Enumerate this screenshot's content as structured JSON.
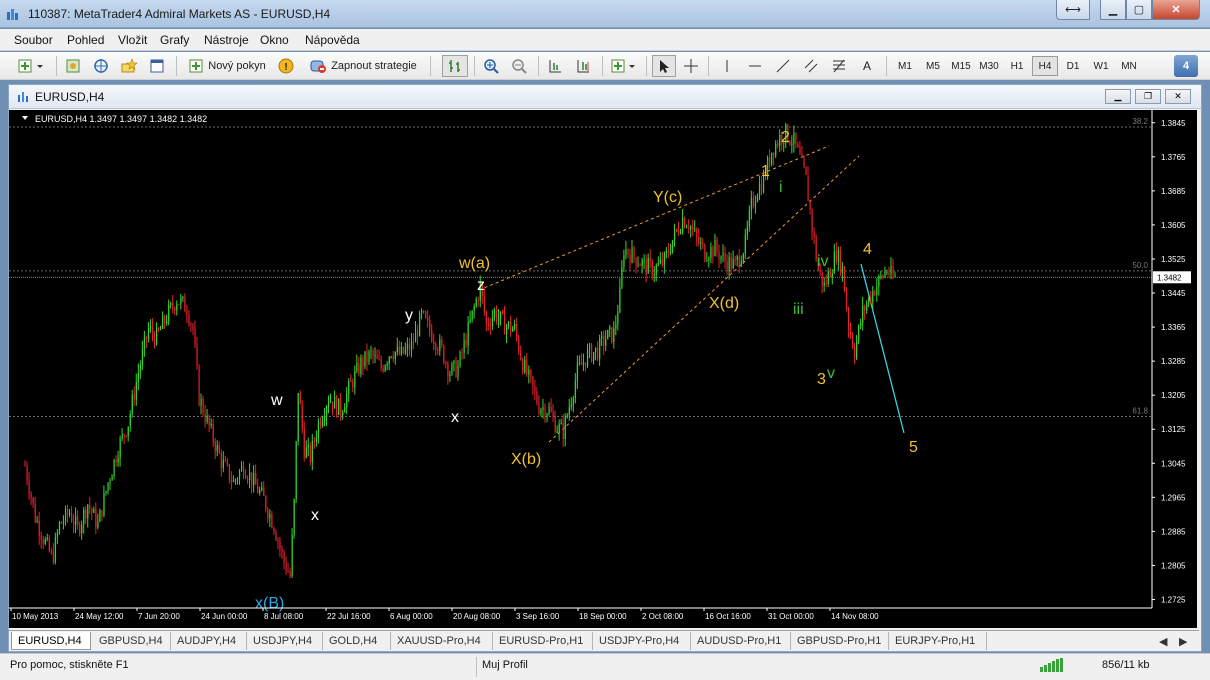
{
  "window": {
    "title": "110387: MetaTrader4 Admiral Markets AS - EURUSD,H4"
  },
  "menu": [
    "Soubor",
    "Pohled",
    "Vložit",
    "Grafy",
    "Nástroje",
    "Okno",
    "Nápověda"
  ],
  "toolbar": {
    "new_order": "Nový pokyn",
    "autotrading": "Zapnout strategie",
    "text_tool": "A",
    "timeframes": [
      "M1",
      "M5",
      "M15",
      "M30",
      "H1",
      "H4",
      "D1",
      "W1",
      "MN"
    ],
    "active_timeframe": "H4",
    "badge": "4"
  },
  "child": {
    "title": "EURUSD,H4"
  },
  "chart_data": {
    "type": "candlestick",
    "symbol_info": "EURUSD,H4  1.3497 1.3497 1.3482 1.3482",
    "current_price": "1.3482",
    "y_ticks": [
      "1.3845",
      "1.3765",
      "1.3685",
      "1.3605",
      "1.3525",
      "1.3445",
      "1.3365",
      "1.3285",
      "1.3205",
      "1.3125",
      "1.3045",
      "1.2965",
      "1.2885",
      "1.2805",
      "1.2725"
    ],
    "x_ticks": [
      "10 May 2013",
      "24 May 12:00",
      "7 Jun 20:00",
      "24 Jun 00:00",
      "8 Jul 08:00",
      "22 Jul 16:00",
      "6 Aug 00:00",
      "20 Aug 08:00",
      "3 Sep 16:00",
      "18 Sep 00:00",
      "2 Oct 08:00",
      "16 Oct 16:00",
      "31 Oct 00:00",
      "14 Nov 08:00"
    ],
    "fib_levels": [
      {
        "label": "38.2",
        "price": 1.3835
      },
      {
        "label": "50.0",
        "price": 1.3497
      },
      {
        "label": "61.8",
        "price": 1.3155
      }
    ],
    "ylim": [
      1.2705,
      1.3875
    ],
    "path": [
      [
        0,
        1.304
      ],
      [
        10,
        1.292
      ],
      [
        18,
        1.287
      ],
      [
        27,
        1.282
      ],
      [
        34,
        1.29
      ],
      [
        44,
        1.293
      ],
      [
        52,
        1.289
      ],
      [
        62,
        1.295
      ],
      [
        72,
        1.29
      ],
      [
        82,
        1.3
      ],
      [
        92,
        1.308
      ],
      [
        102,
        1.314
      ],
      [
        112,
        1.326
      ],
      [
        122,
        1.336
      ],
      [
        130,
        1.334
      ],
      [
        140,
        1.339
      ],
      [
        150,
        1.343
      ],
      [
        160,
        1.341
      ],
      [
        166,
        1.336
      ],
      [
        172,
        1.32
      ],
      [
        182,
        1.313
      ],
      [
        194,
        1.305
      ],
      [
        206,
        1.3
      ],
      [
        216,
        1.304
      ],
      [
        226,
        1.3
      ],
      [
        236,
        1.296
      ],
      [
        246,
        1.29
      ],
      [
        255,
        1.282
      ],
      [
        262,
        1.278
      ],
      [
        266,
        1.295
      ],
      [
        270,
        1.322
      ],
      [
        276,
        1.308
      ],
      [
        282,
        1.306
      ],
      [
        290,
        1.314
      ],
      [
        300,
        1.32
      ],
      [
        312,
        1.317
      ],
      [
        322,
        1.323
      ],
      [
        332,
        1.328
      ],
      [
        342,
        1.33
      ],
      [
        352,
        1.327
      ],
      [
        362,
        1.331
      ],
      [
        372,
        1.33
      ],
      [
        382,
        1.332
      ],
      [
        392,
        1.339
      ],
      [
        402,
        1.335
      ],
      [
        412,
        1.331
      ],
      [
        420,
        1.326
      ],
      [
        428,
        1.327
      ],
      [
        436,
        1.334
      ],
      [
        444,
        1.341
      ],
      [
        450,
        1.346
      ],
      [
        456,
        1.337
      ],
      [
        464,
        1.34
      ],
      [
        474,
        1.337
      ],
      [
        484,
        1.336
      ],
      [
        492,
        1.328
      ],
      [
        500,
        1.323
      ],
      [
        508,
        1.318
      ],
      [
        518,
        1.317
      ],
      [
        526,
        1.313
      ],
      [
        532,
        1.312
      ],
      [
        538,
        1.318
      ],
      [
        546,
        1.326
      ],
      [
        556,
        1.33
      ],
      [
        566,
        1.331
      ],
      [
        574,
        1.334
      ],
      [
        582,
        1.335
      ],
      [
        588,
        1.344
      ],
      [
        592,
        1.355
      ],
      [
        602,
        1.353
      ],
      [
        612,
        1.351
      ],
      [
        622,
        1.35
      ],
      [
        632,
        1.352
      ],
      [
        640,
        1.357
      ],
      [
        650,
        1.362
      ],
      [
        656,
        1.361
      ],
      [
        664,
        1.357
      ],
      [
        672,
        1.354
      ],
      [
        682,
        1.355
      ],
      [
        692,
        1.352
      ],
      [
        702,
        1.351
      ],
      [
        712,
        1.356
      ],
      [
        718,
        1.365
      ],
      [
        724,
        1.369
      ],
      [
        730,
        1.371
      ],
      [
        738,
        1.378
      ],
      [
        746,
        1.381
      ],
      [
        752,
        1.382
      ],
      [
        760,
        1.38
      ],
      [
        766,
        1.376
      ],
      [
        772,
        1.371
      ],
      [
        778,
        1.36
      ],
      [
        784,
        1.35
      ],
      [
        790,
        1.346
      ],
      [
        796,
        1.35
      ],
      [
        802,
        1.354
      ],
      [
        808,
        1.35
      ],
      [
        814,
        1.337
      ],
      [
        820,
        1.331
      ],
      [
        828,
        1.34
      ],
      [
        836,
        1.344
      ],
      [
        846,
        1.348
      ],
      [
        852,
        1.35
      ],
      [
        858,
        1.348
      ]
    ],
    "x_span": 860
  },
  "annotations": [
    {
      "text": "w",
      "x": 262,
      "y": 295,
      "color": "#ffffff"
    },
    {
      "text": "x",
      "x": 302,
      "y": 410,
      "color": "#ffffff"
    },
    {
      "text": "x(B)",
      "x": 246,
      "y": 498,
      "color": "#2aa9e8"
    },
    {
      "text": "y",
      "x": 396,
      "y": 210,
      "color": "#ffffff"
    },
    {
      "text": "x",
      "x": 442,
      "y": 312,
      "color": "#ffffff"
    },
    {
      "text": "w(a)",
      "x": 450,
      "y": 158,
      "color": "#f2c12e"
    },
    {
      "text": "z",
      "x": 468,
      "y": 180,
      "color": "#ffffff"
    },
    {
      "text": "X(b)",
      "x": 502,
      "y": 354,
      "color": "#f2c12e"
    },
    {
      "text": "Y(c)",
      "x": 644,
      "y": 92,
      "color": "#f2c12e"
    },
    {
      "text": "X(d)",
      "x": 700,
      "y": 198,
      "color": "#f2c12e"
    },
    {
      "text": "1",
      "x": 752,
      "y": 66,
      "color": "#f2c12e"
    },
    {
      "text": "2",
      "x": 772,
      "y": 32,
      "color": "#f2c12e"
    },
    {
      "text": "i",
      "x": 770,
      "y": 82,
      "color": "#39c13a"
    },
    {
      "text": "iv",
      "x": 808,
      "y": 156,
      "color": "#39c13a"
    },
    {
      "text": "iii",
      "x": 784,
      "y": 204,
      "color": "#39c13a"
    },
    {
      "text": "3",
      "x": 808,
      "y": 274,
      "color": "#f2c12e"
    },
    {
      "text": "v",
      "x": 818,
      "y": 268,
      "color": "#39c13a"
    },
    {
      "text": "4",
      "x": 854,
      "y": 144,
      "color": "#f2c12e"
    },
    {
      "text": "5",
      "x": 900,
      "y": 342,
      "color": "#f2c12e"
    }
  ],
  "tabs": [
    "EURUSD,H4",
    "GBPUSD,H4",
    "AUDJPY,H4",
    "USDJPY,H4",
    "GOLD,H4",
    "XAUUSD-Pro,H4",
    "EURUSD-Pro,H1",
    "USDJPY-Pro,H4",
    "AUDUSD-Pro,H1",
    "GBPUSD-Pro,H1",
    "EURJPY-Pro,H1"
  ],
  "status": {
    "help": "Pro pomoc, stiskněte F1",
    "profile": "Muj Profil",
    "traffic": "856/11 kb"
  }
}
